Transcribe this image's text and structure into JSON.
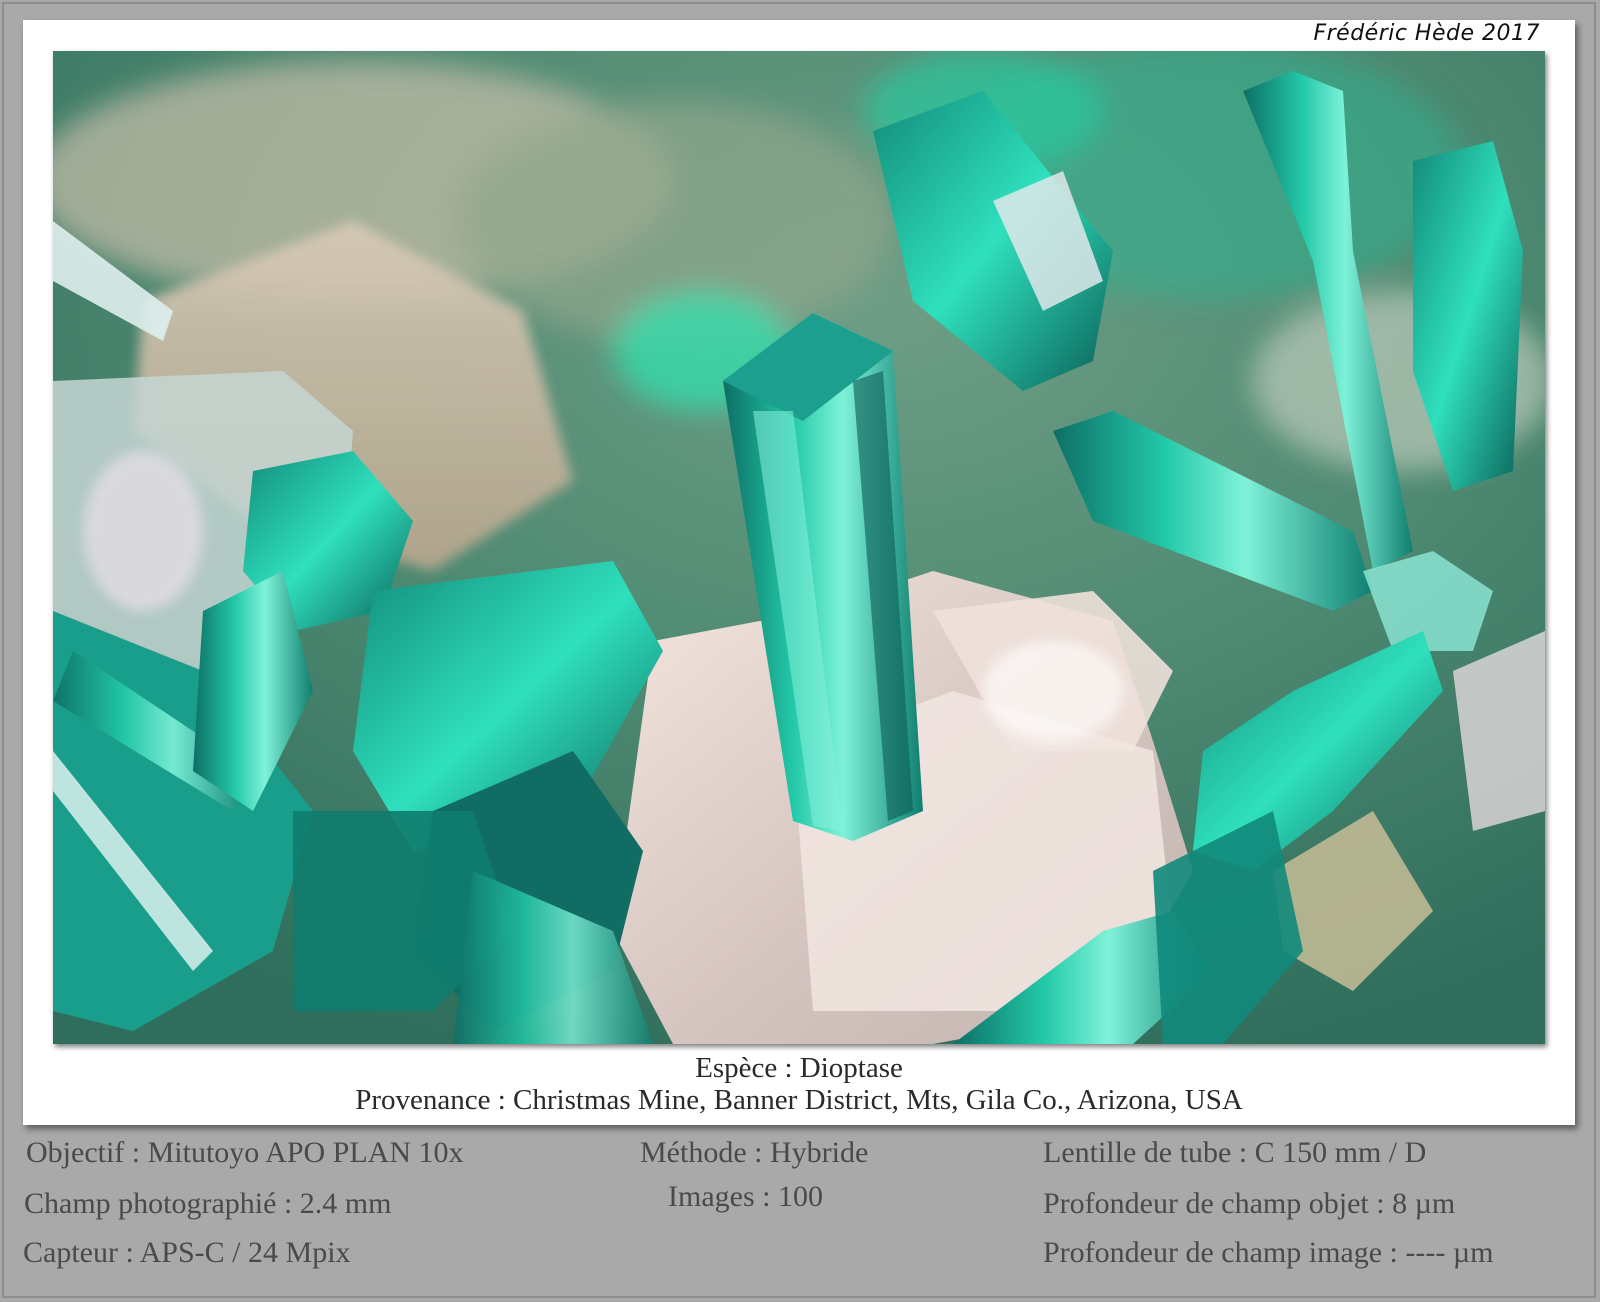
{
  "signature": "Frédéric Hède 2017",
  "caption": {
    "species": "Espèce : Dioptase",
    "provenance": "Provenance : Christmas Mine, Banner District, Mts, Gila Co., Arizona, USA"
  },
  "specs": {
    "objective": "Objectif : Mitutoyo APO PLAN 10x",
    "field": "Champ photographié : 2.4 mm",
    "sensor": "Capteur : APS-C / 24 Mpix",
    "method": "Méthode : Hybride",
    "images": "Images : 100",
    "tube_lens": "Lentille de tube : C 150 mm / D",
    "object_dof": "Profondeur de champ objet : 8 µm",
    "image_dof": "Profondeur de champ image : ---- µm"
  },
  "colors": {
    "background": "#a9a9a9",
    "card": "#ffffff",
    "text": "#4a4a4a",
    "crystal": "#1fc7a6"
  }
}
